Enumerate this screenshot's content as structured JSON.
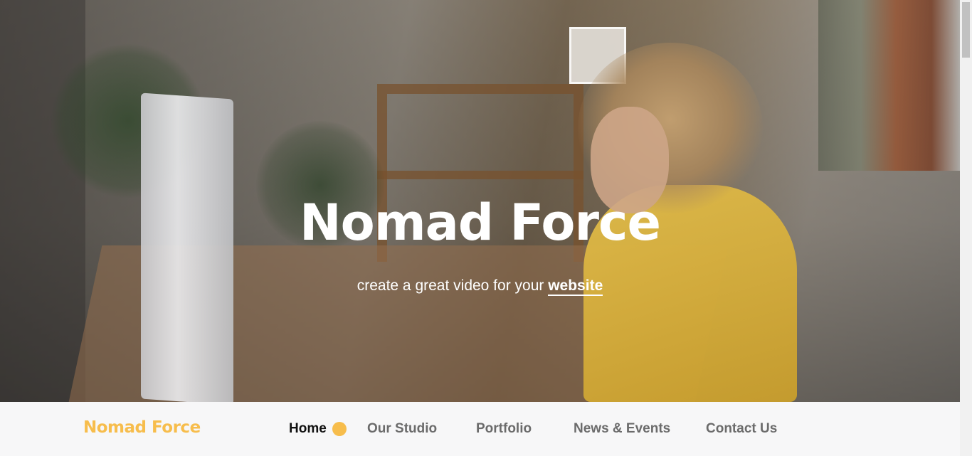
{
  "hero": {
    "title": "Nomad Force",
    "tagline_prefix": "create a great video for your ",
    "tagline_emphasis": "website"
  },
  "navbar": {
    "brand": "Nomad Force",
    "items": [
      {
        "label": "Home",
        "active": true
      },
      {
        "label": "Our Studio",
        "active": false
      },
      {
        "label": "Portfolio",
        "active": false
      },
      {
        "label": "News & Events",
        "active": false
      },
      {
        "label": "Contact Us",
        "active": false
      }
    ]
  },
  "colors": {
    "accent": "#f7bd4c",
    "nav_active": "#111111",
    "nav_inactive": "#6b6b6b",
    "navbar_bg": "#f7f7f8"
  }
}
